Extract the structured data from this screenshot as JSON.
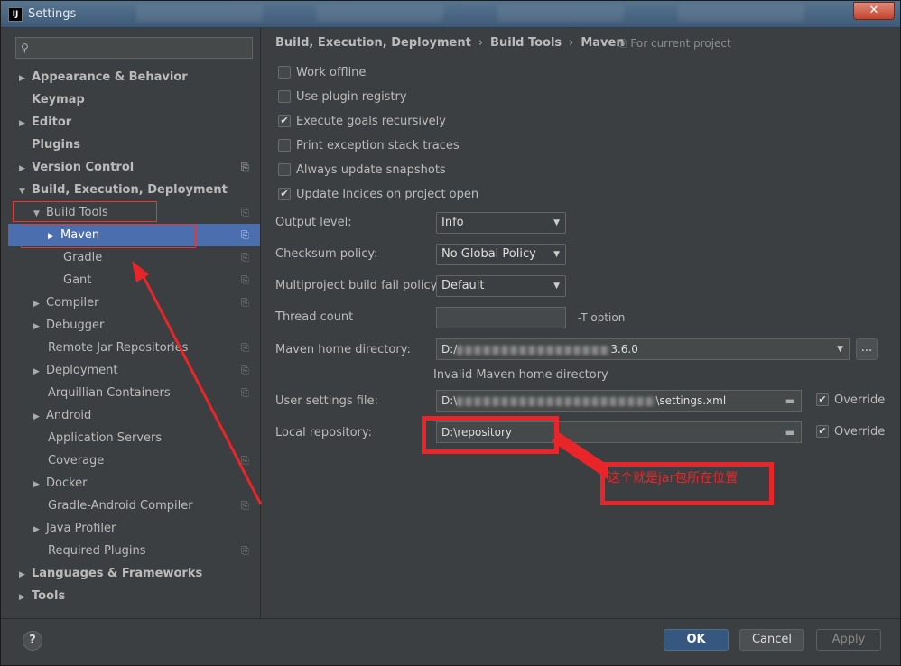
{
  "window": {
    "title": "Settings",
    "app_icon_text": "IJ",
    "close_glyph": "✕"
  },
  "search": {
    "placeholder": "",
    "icon": "search-icon"
  },
  "tree": [
    {
      "label": "Appearance & Behavior",
      "arrow": "▶"
    },
    {
      "label": "Keymap",
      "arrow": ""
    },
    {
      "label": "Editor",
      "arrow": "▶"
    },
    {
      "label": "Plugins",
      "arrow": ""
    },
    {
      "label": "Version Control",
      "arrow": "▶"
    },
    {
      "label": "Build, Execution, Deployment",
      "arrow": "▼"
    },
    {
      "label": "Build Tools",
      "arrow": "▼"
    },
    {
      "label": "Maven",
      "arrow": "▶"
    },
    {
      "label": "Gradle",
      "arrow": ""
    },
    {
      "label": "Gant",
      "arrow": ""
    },
    {
      "label": "Compiler",
      "arrow": "▶"
    },
    {
      "label": "Debugger",
      "arrow": "▶"
    },
    {
      "label": "Remote Jar Repositories",
      "arrow": ""
    },
    {
      "label": "Deployment",
      "arrow": "▶"
    },
    {
      "label": "Arquillian Containers",
      "arrow": ""
    },
    {
      "label": "Android",
      "arrow": "▶"
    },
    {
      "label": "Application Servers",
      "arrow": ""
    },
    {
      "label": "Coverage",
      "arrow": ""
    },
    {
      "label": "Docker",
      "arrow": "▶"
    },
    {
      "label": "Gradle-Android Compiler",
      "arrow": ""
    },
    {
      "label": "Java Profiler",
      "arrow": "▶"
    },
    {
      "label": "Required Plugins",
      "arrow": ""
    },
    {
      "label": "Languages & Frameworks",
      "arrow": "▶"
    },
    {
      "label": "Tools",
      "arrow": "▶"
    }
  ],
  "breadcrumb": {
    "part1": "Build, Execution, Deployment",
    "part2": "Build Tools",
    "part3": "Maven",
    "separator": "›",
    "scope": "⎘ For current project"
  },
  "checkboxes": [
    {
      "label": "Work offline",
      "checked": false
    },
    {
      "label": "Use plugin registry",
      "checked": false
    },
    {
      "label": "Execute goals recursively",
      "checked": true
    },
    {
      "label": "Print exception stack traces",
      "checked": false
    },
    {
      "label": "Always update snapshots",
      "checked": false
    },
    {
      "label": "Update Incices on project open",
      "checked": true
    }
  ],
  "check_glyph": "✔",
  "fields": {
    "output_level": {
      "label": "Output level:",
      "value": "Info"
    },
    "checksum_policy": {
      "label": "Checksum policy:",
      "value": "No Global Policy"
    },
    "fail_policy": {
      "label": "Multiproject build fail policy:",
      "value": "Default"
    },
    "thread_count": {
      "label": "Thread count",
      "value": "",
      "hint": "-T option"
    },
    "maven_home": {
      "label": "Maven home directory:",
      "prefix": "D:/",
      "suffix": "3.6.0",
      "error": "Invalid Maven home directory",
      "browse": "..."
    },
    "user_settings": {
      "label": "User settings file:",
      "prefix": "D:\\",
      "suffix": "\\settings.xml",
      "override": "Override"
    },
    "local_repo": {
      "label": "Local repository:",
      "value": "D:\\repository",
      "override": "Override"
    }
  },
  "chevron": "▼",
  "folder_glyph": "▬",
  "annotation": {
    "text": "这个就是jar包所在位置",
    "color": "#e8262a"
  },
  "footer": {
    "help": "?",
    "ok": "OK",
    "cancel": "Cancel",
    "apply": "Apply"
  }
}
